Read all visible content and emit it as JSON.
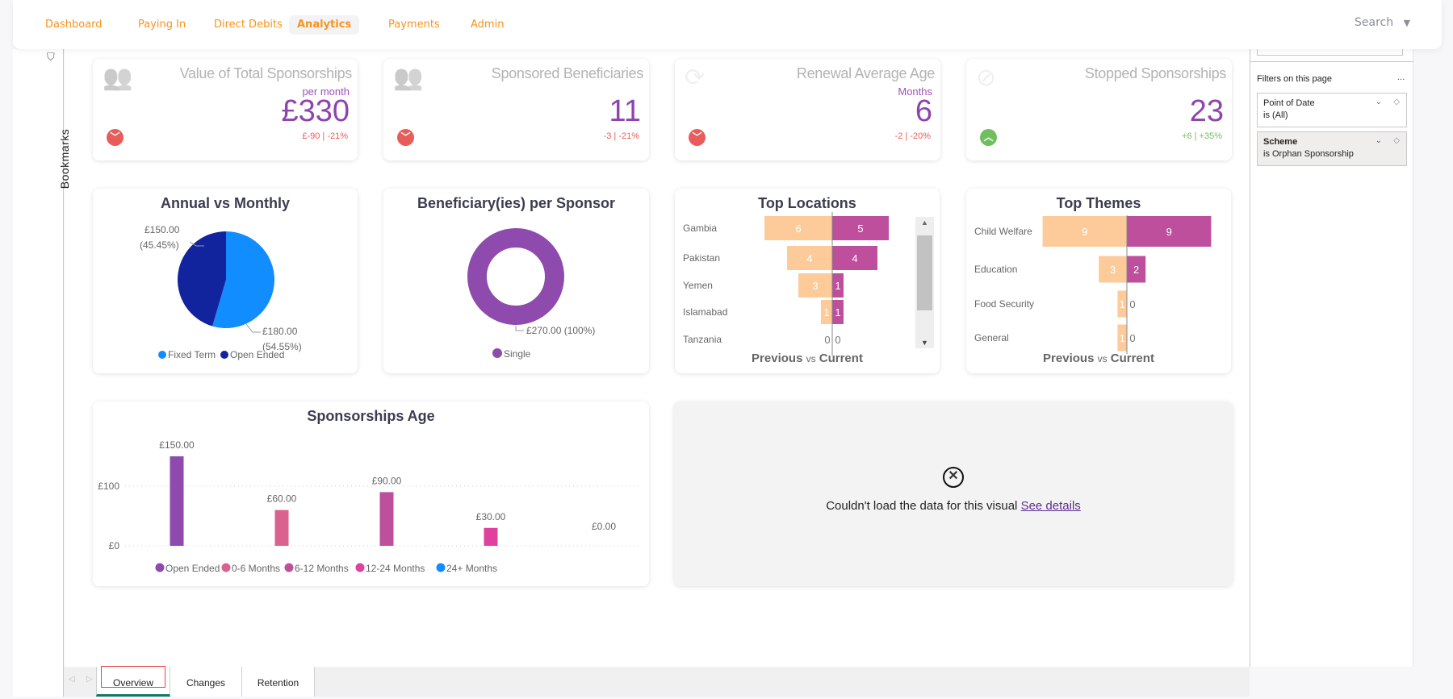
{
  "nav": {
    "items": [
      {
        "label": "Dashboard"
      },
      {
        "label": "Paying In"
      },
      {
        "label": "Direct Debits"
      },
      {
        "label": "Analytics",
        "active": true
      },
      {
        "label": "Payments"
      },
      {
        "label": "Admin"
      }
    ],
    "search_label": "Search"
  },
  "bookmarks": {
    "label": "Bookmarks"
  },
  "filters": {
    "title": "Filters on this page",
    "more": "...",
    "cards": [
      {
        "name": "Point of Date",
        "value": "is (All)"
      },
      {
        "name": "Scheme",
        "value": "is Orphan Sponsorship"
      }
    ]
  },
  "kpis": [
    {
      "title": "Value of Total Sponsorships",
      "sub": "per month",
      "value": "£330",
      "change": "£-90 | -21%",
      "trend": "down",
      "icon": "sponsor-document-icon"
    },
    {
      "title": "Sponsored Beneficiaries",
      "sub": "",
      "value": "11",
      "change": "-3 | -21%",
      "trend": "down",
      "icon": "beneficiary-icon"
    },
    {
      "title": "Renewal Average Age",
      "sub": "Months",
      "value": "6",
      "change": "-2 | -20%",
      "trend": "down",
      "icon": "renewal-chart-icon"
    },
    {
      "title": "Stopped Sponsorships",
      "sub": "",
      "value": "23",
      "change": "+6 | +35%",
      "trend": "up",
      "icon": "stopped-icon"
    }
  ],
  "colors": {
    "down": "#e85c5c",
    "up": "#6fbf5f",
    "previous": "#fdcb9a",
    "current": "#bd4f9d",
    "accent": "#f7941d"
  },
  "chart_data": [
    {
      "type": "pie",
      "title": "Annual vs Monthly",
      "slices": [
        {
          "name": "Fixed Term",
          "value": 180,
          "label": "£180.00",
          "pct": "(54.55%)",
          "color": "#118dff"
        },
        {
          "name": "Open Ended",
          "value": 150,
          "label": "£150.00",
          "pct": "(45.45%)",
          "color": "#12239e"
        }
      ]
    },
    {
      "type": "pie",
      "title": "Beneficiary(ies) per Sponsor",
      "donut": true,
      "slices": [
        {
          "name": "Single",
          "value": 270,
          "label": "£270.00 (100%)",
          "color": "#8e4bad"
        }
      ]
    },
    {
      "type": "bar",
      "title": "Top Locations",
      "orientation": "diverging",
      "categories": [
        "Gambia",
        "Pakistan",
        "Yemen",
        "Islamabad",
        "Tanzania"
      ],
      "series": [
        {
          "name": "Previous",
          "values": [
            6,
            4,
            3,
            1,
            0
          ]
        },
        {
          "name": "Current",
          "values": [
            5,
            4,
            1,
            1,
            0
          ]
        }
      ],
      "footer": {
        "a": "Previous",
        "vs": "vs",
        "b": "Current"
      }
    },
    {
      "type": "bar",
      "title": "Top Themes",
      "orientation": "diverging",
      "categories": [
        "Child Welfare",
        "Education",
        "Food Security",
        "General"
      ],
      "series": [
        {
          "name": "Previous",
          "values": [
            9,
            3,
            1,
            1
          ]
        },
        {
          "name": "Current",
          "values": [
            9,
            2,
            0,
            0
          ]
        }
      ],
      "footer": {
        "a": "Previous",
        "vs": "vs",
        "b": "Current"
      }
    },
    {
      "type": "bar",
      "title": "Sponsorships Age",
      "categories": [
        "Open Ended",
        "0-6 Months",
        "6-12 Months",
        "12-24 Months",
        "24+ Months"
      ],
      "values": [
        150,
        60,
        90,
        30,
        0
      ],
      "labels": [
        "£150.00",
        "£60.00",
        "£90.00",
        "£30.00",
        "£0.00"
      ],
      "colors": [
        "#8e4bad",
        "#d9628f",
        "#bd4f9d",
        "#e040a0",
        "#118dff"
      ],
      "yticks": [
        "£0",
        "£100"
      ],
      "ylim": [
        0,
        165
      ],
      "legend": "bottom",
      "grid": true
    }
  ],
  "error_visual": {
    "message": "Couldn't load the data for this visual",
    "link": "See details"
  },
  "tabs": [
    {
      "label": "Overview",
      "active": true
    },
    {
      "label": "Changes"
    },
    {
      "label": "Retention"
    }
  ]
}
